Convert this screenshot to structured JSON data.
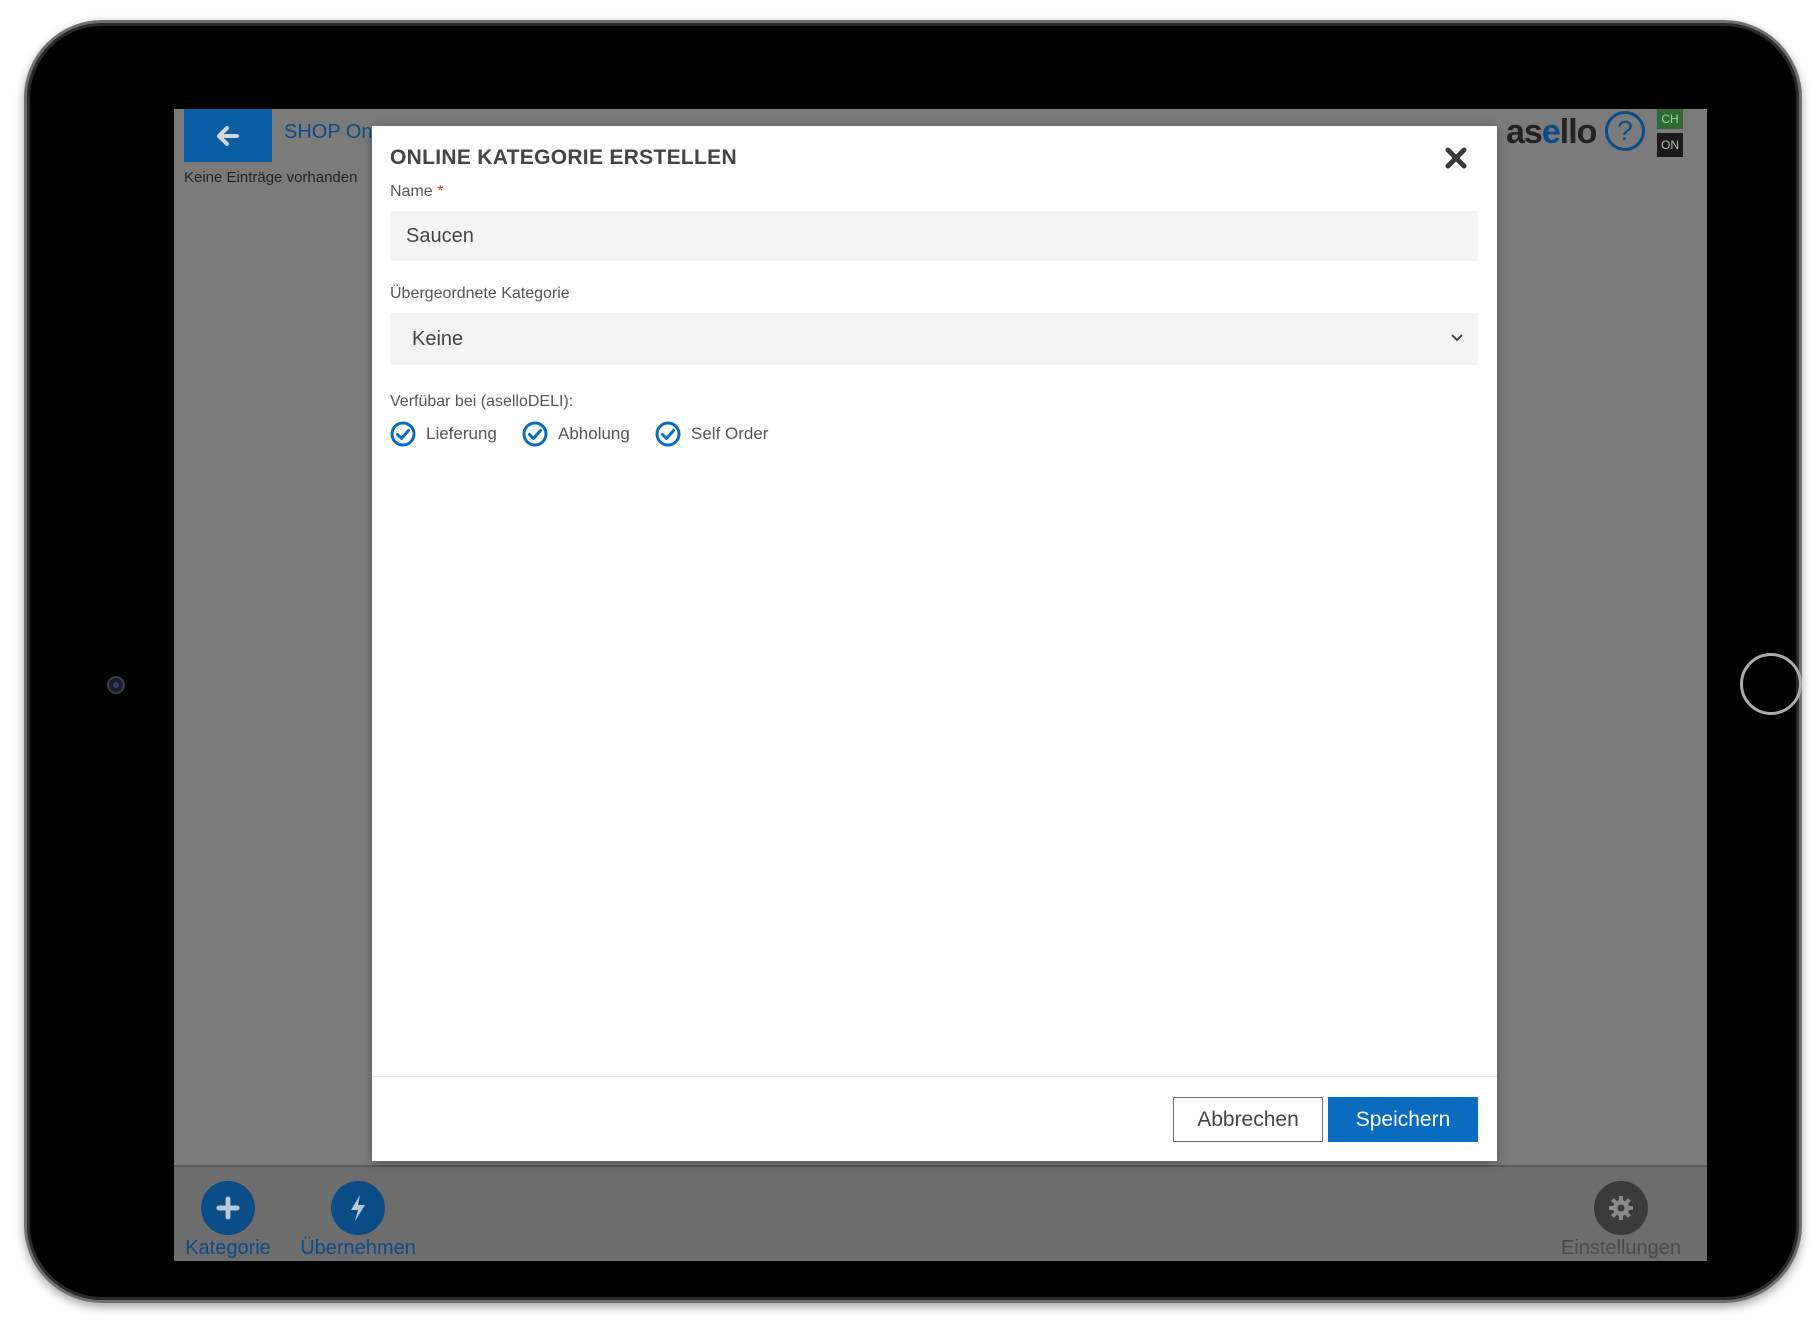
{
  "app": {
    "header_title": "SHOP On",
    "empty_message": "Keine Einträge vorhanden",
    "logo": {
      "part1": "as",
      "part2": "e",
      "part3": "llo"
    },
    "help_icon": "question-mark-icon",
    "badges": {
      "top": "CH",
      "bottom": "ON"
    },
    "colors": {
      "primary": "#0a6cbf",
      "header_blue": "#0a5ea4",
      "overlay": "#7b7b7b"
    }
  },
  "bottom_bar": {
    "items": [
      {
        "label": "Kategorie",
        "icon": "plus-icon"
      },
      {
        "label": "Übernehmen",
        "icon": "lightning-icon"
      },
      {
        "label": "Einstellungen",
        "icon": "gear-icon"
      }
    ]
  },
  "modal": {
    "title": "ONLINE KATEGORIE ERSTELLEN",
    "name_field": {
      "label": "Name",
      "required_marker": "*",
      "value": "Saucen"
    },
    "parent_field": {
      "label": "Übergeordnete Kategorie",
      "value": "Keine"
    },
    "availability": {
      "label": "Verfübar bei (aselloDELI):",
      "options": [
        {
          "label": "Lieferung",
          "checked": true
        },
        {
          "label": "Abholung",
          "checked": true
        },
        {
          "label": "Self Order",
          "checked": true
        }
      ]
    },
    "cancel_label": "Abbrechen",
    "save_label": "Speichern"
  }
}
